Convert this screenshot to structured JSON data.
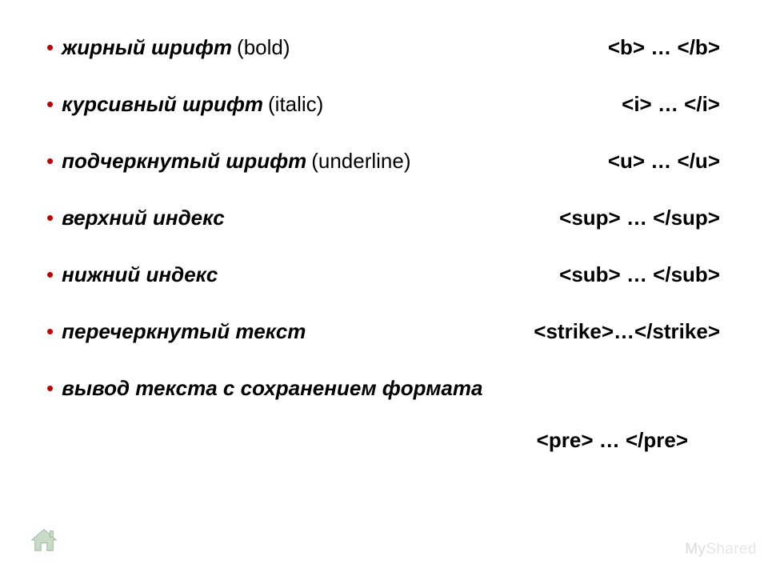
{
  "items": [
    {
      "desc": "жирный шрифт",
      "paren": "(bold)",
      "code": "<b> … </b>"
    },
    {
      "desc": "курсивный шрифт",
      "paren": "(italic)",
      "code": "<i> … </i>"
    },
    {
      "desc": "подчеркнутый шрифт",
      "paren": "(underline)",
      "code": "<u> … </u>"
    },
    {
      "desc": "верхний индекс",
      "paren": "",
      "code": "<sup> … </sup>"
    },
    {
      "desc": "нижний индекс",
      "paren": "",
      "code": "<sub> … </sub>"
    },
    {
      "desc": "перечеркнутый текст",
      "paren": "",
      "code": "<strike>…</strike>"
    },
    {
      "desc": "вывод текста с сохранением формата",
      "paren": "",
      "code": ""
    }
  ],
  "pre_code": "<pre> … </pre>",
  "bullet": "•",
  "watermark": {
    "my": "My",
    "shared": "Shared"
  }
}
